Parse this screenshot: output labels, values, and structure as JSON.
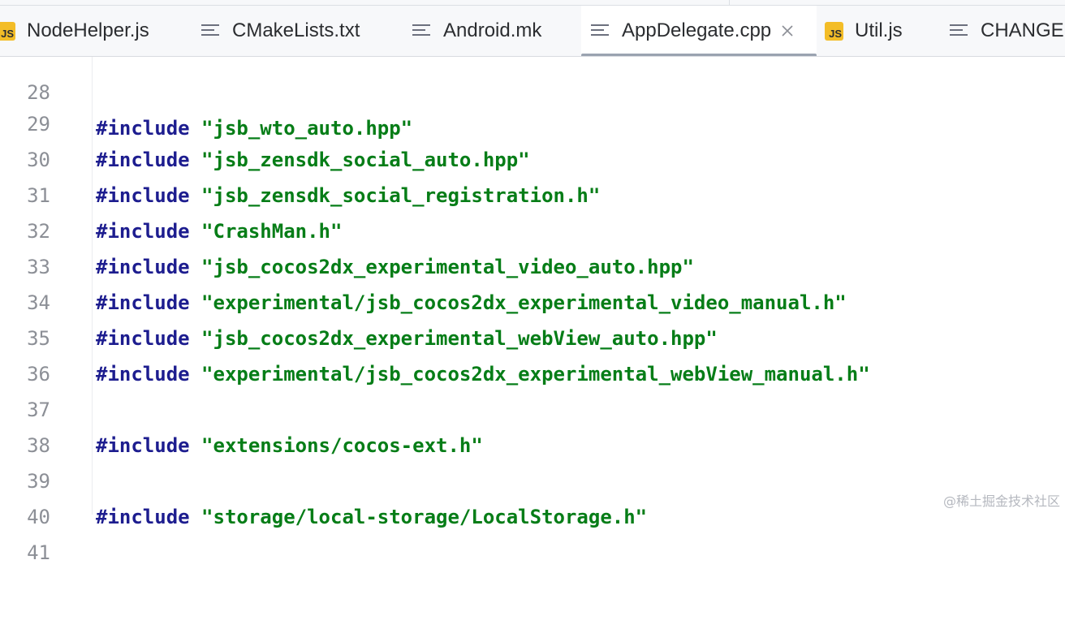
{
  "tabs": [
    {
      "label": "NodeHelper.js",
      "icon": "js-file-icon",
      "active": false
    },
    {
      "label": "CMakeLists.txt",
      "icon": "text-file-icon",
      "active": false
    },
    {
      "label": "Android.mk",
      "icon": "text-file-icon",
      "active": false
    },
    {
      "label": "AppDelegate.cpp",
      "icon": "text-file-icon",
      "active": true
    },
    {
      "label": "Util.js",
      "icon": "js-file-icon",
      "active": false
    },
    {
      "label": "CHANGEL",
      "icon": "text-file-icon",
      "active": false
    }
  ],
  "js_icon_text": "JS",
  "editor": {
    "lines": [
      {
        "num": "28",
        "kw": "#include",
        "str": "\"jsb_wto_auto.hpp\""
      },
      {
        "num": "29",
        "kw": "#include",
        "str": "\"jsb_zensdk_social_auto.hpp\""
      },
      {
        "num": "30",
        "kw": "#include",
        "str": "\"jsb_zensdk_social_registration.h\""
      },
      {
        "num": "31",
        "kw": "#include",
        "str": "\"CrashMan.h\""
      },
      {
        "num": "32",
        "kw": "#include",
        "str": "\"jsb_cocos2dx_experimental_video_auto.hpp\""
      },
      {
        "num": "33",
        "kw": "#include",
        "str": "\"experimental/jsb_cocos2dx_experimental_video_manual.h\""
      },
      {
        "num": "34",
        "kw": "#include",
        "str": "\"jsb_cocos2dx_experimental_webView_auto.hpp\""
      },
      {
        "num": "35",
        "kw": "#include",
        "str": "\"experimental/jsb_cocos2dx_experimental_webView_manual.h\""
      },
      {
        "num": "36",
        "kw": "",
        "str": ""
      },
      {
        "num": "37",
        "kw": "#include",
        "str": "\"extensions/cocos-ext.h\""
      },
      {
        "num": "38",
        "kw": "",
        "str": ""
      },
      {
        "num": "39",
        "kw": "#include",
        "str": "\"storage/local-storage/LocalStorage.h\""
      },
      {
        "num": "40",
        "kw": "",
        "str": ""
      },
      {
        "num": "41",
        "kw": "",
        "str": ""
      }
    ]
  },
  "watermark": "@稀土掘金技术社区",
  "colors": {
    "keyword": "#1d1d8f",
    "string": "#067d17",
    "line_number": "#8c8f96",
    "js_badge": "#f3bd27"
  }
}
